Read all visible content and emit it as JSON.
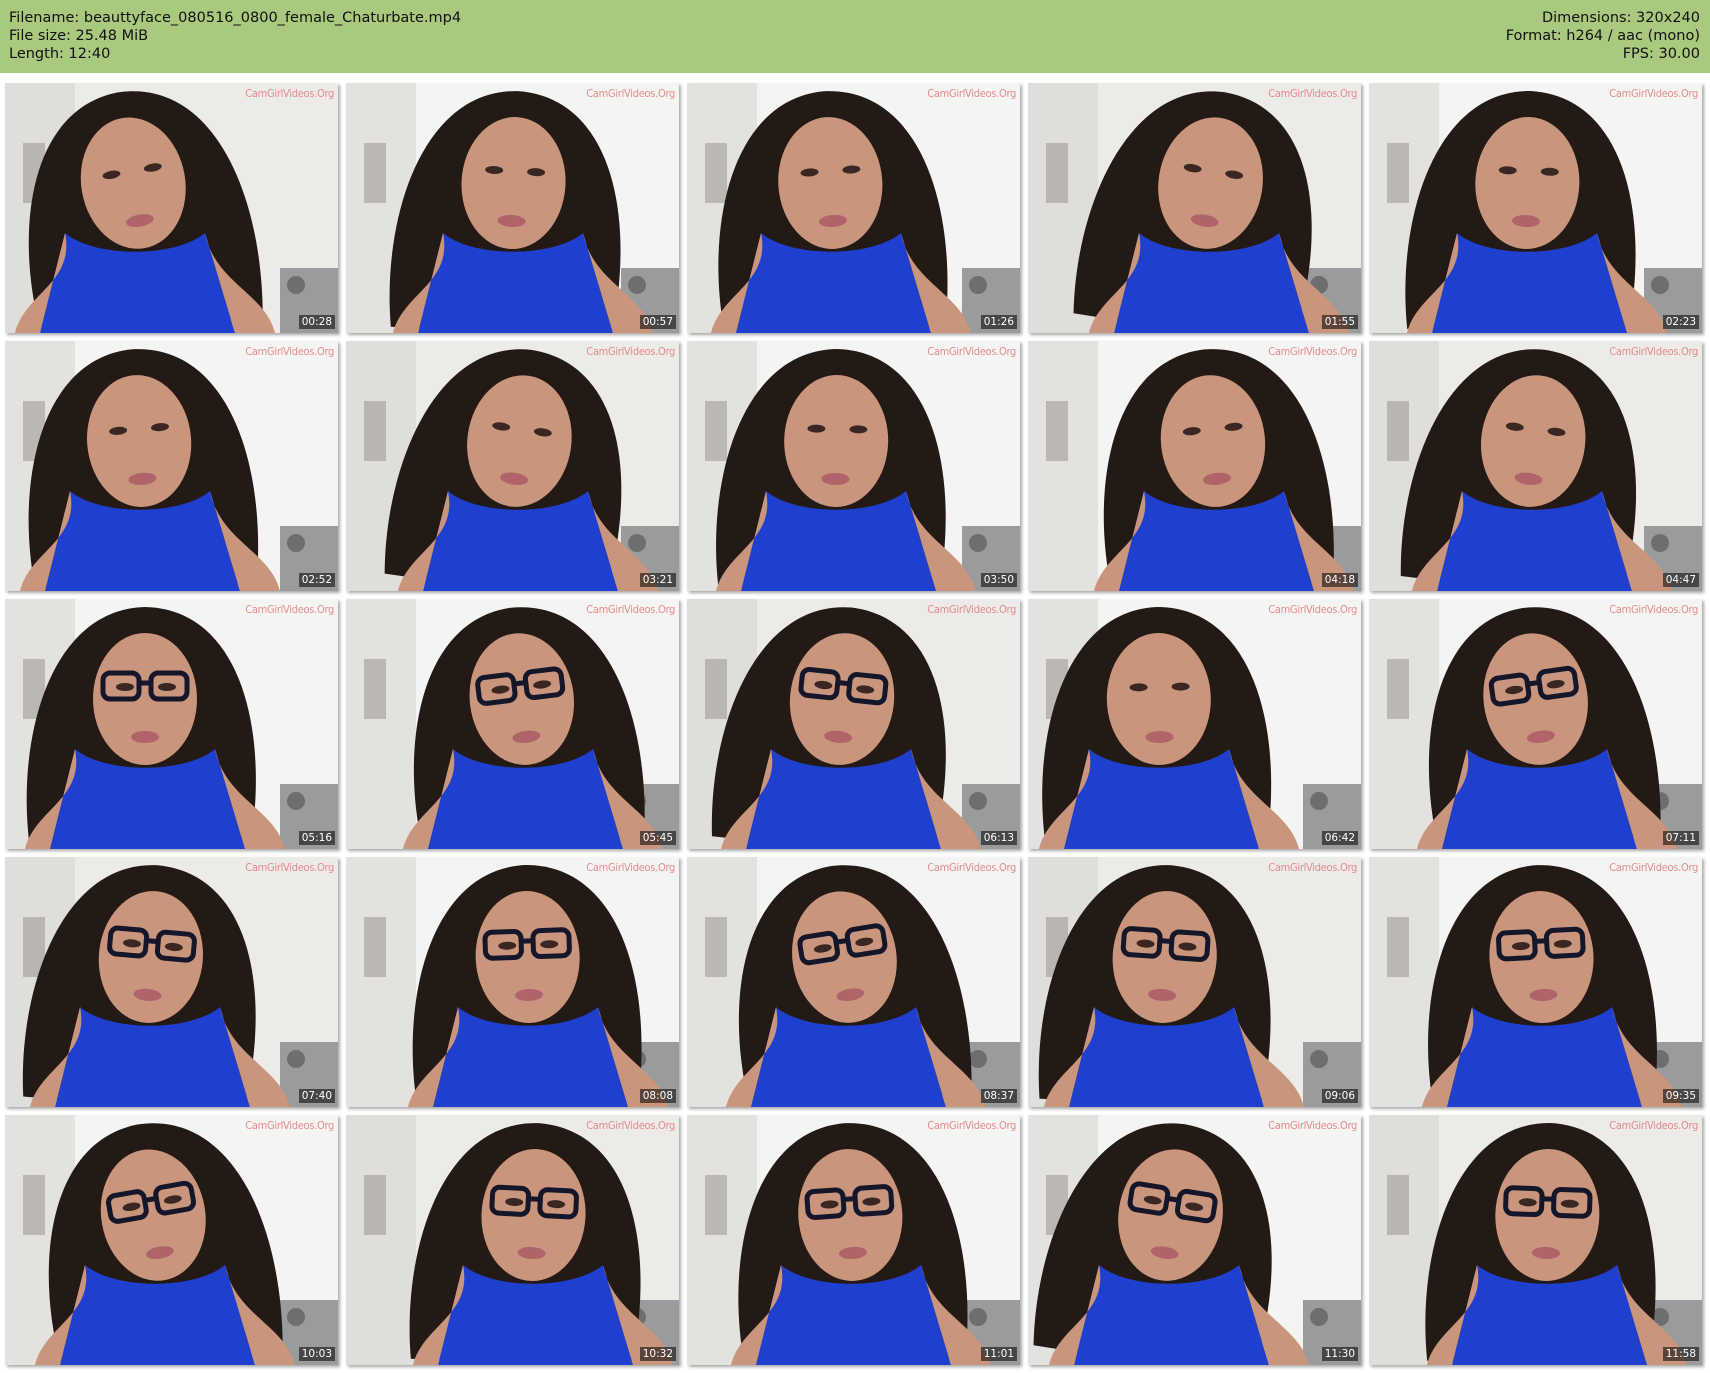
{
  "header": {
    "filename_line": "Filename: beauttyface_080516_0800_female_Chaturbate.mp4",
    "filesize_line": "File size: 25.48 MiB",
    "length_line": "Length: 12:40",
    "dimensions_line": "Dimensions: 320x240",
    "format_line": "Format: h264 / aac (mono)",
    "fps_line": "FPS: 30.00"
  },
  "watermark": "CamGirlVideos.Org",
  "colors": {
    "header_bg": "#a9c97f",
    "top_blue": "#1f3fcf",
    "hair": "#231915",
    "skin": "#c9957c"
  },
  "thumbnails": [
    {
      "time": "00:28",
      "glasses": false
    },
    {
      "time": "00:57",
      "glasses": false
    },
    {
      "time": "01:26",
      "glasses": false
    },
    {
      "time": "01:55",
      "glasses": false
    },
    {
      "time": "02:23",
      "glasses": false
    },
    {
      "time": "02:52",
      "glasses": false
    },
    {
      "time": "03:21",
      "glasses": false
    },
    {
      "time": "03:50",
      "glasses": false
    },
    {
      "time": "04:18",
      "glasses": false
    },
    {
      "time": "04:47",
      "glasses": false
    },
    {
      "time": "05:16",
      "glasses": true
    },
    {
      "time": "05:45",
      "glasses": true
    },
    {
      "time": "06:13",
      "glasses": true
    },
    {
      "time": "06:42",
      "glasses": false
    },
    {
      "time": "07:11",
      "glasses": true
    },
    {
      "time": "07:40",
      "glasses": true
    },
    {
      "time": "08:08",
      "glasses": true
    },
    {
      "time": "08:37",
      "glasses": true
    },
    {
      "time": "09:06",
      "glasses": true
    },
    {
      "time": "09:35",
      "glasses": true
    },
    {
      "time": "10:03",
      "glasses": true
    },
    {
      "time": "10:32",
      "glasses": true
    },
    {
      "time": "11:01",
      "glasses": true
    },
    {
      "time": "11:30",
      "glasses": true
    },
    {
      "time": "11:58",
      "glasses": true
    }
  ]
}
